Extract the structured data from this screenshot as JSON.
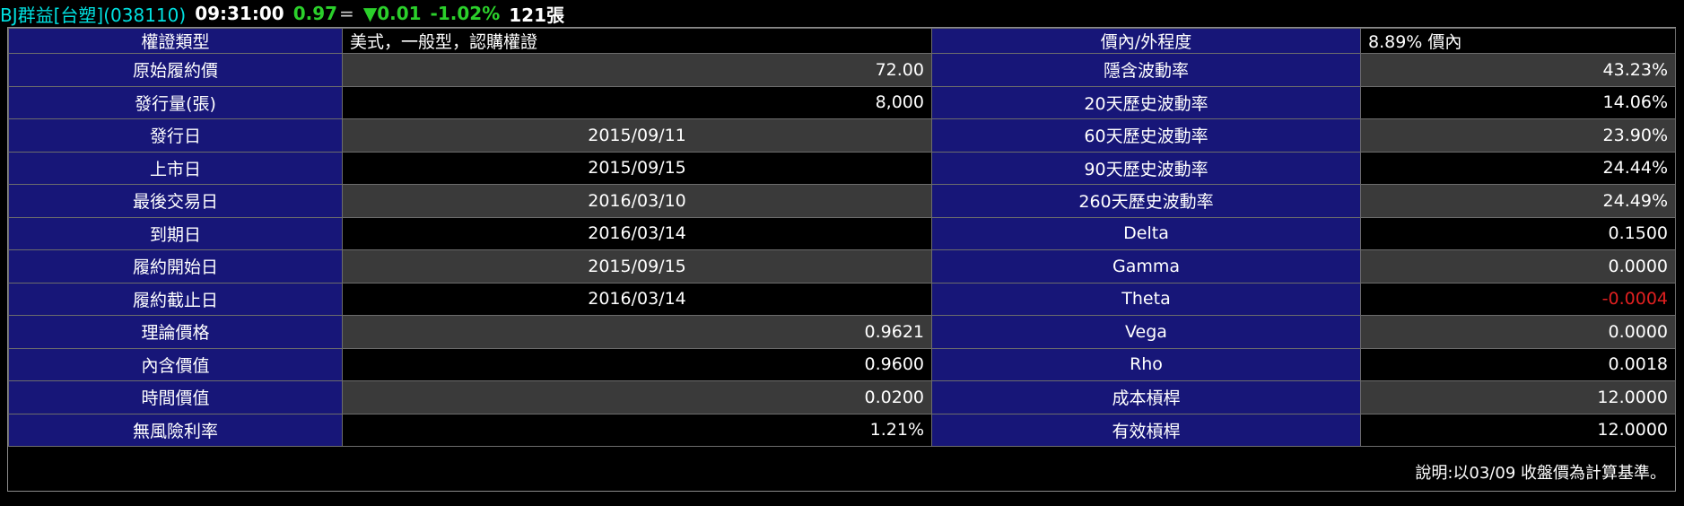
{
  "ticker": {
    "name": "BJ群益[台塑](038110)",
    "time": "09:31:00",
    "price": "0.97",
    "flat_mark": "=",
    "change": "▼0.01",
    "change_pct": "-1.02%",
    "volume": "121張"
  },
  "colors": {
    "label_bg": "#171678",
    "label_text": "#a9bfff",
    "row_gray": "#3a3a3a",
    "row_black": "#000000",
    "up_green": "#2bd02b",
    "negative_red": "#e02020",
    "ticker_name": "#00e0e0"
  },
  "rows": [
    {
      "label1": "權證類型",
      "value1": "美式，一般型，認購權證",
      "label2": "價內/外程度",
      "value2": "8.89% 價內"
    },
    {
      "label1": "原始履約價",
      "value1": "72.00",
      "label2": "隱含波動率",
      "value2": "43.23%"
    },
    {
      "label1": "發行量(張)",
      "value1": "8,000",
      "label2": "20天歷史波動率",
      "value2": "14.06%"
    },
    {
      "label1": "發行日",
      "value1": "2015/09/11",
      "label2": "60天歷史波動率",
      "value2": "23.90%"
    },
    {
      "label1": "上市日",
      "value1": "2015/09/15",
      "label2": "90天歷史波動率",
      "value2": "24.44%"
    },
    {
      "label1": "最後交易日",
      "value1": "2016/03/10",
      "label2": "260天歷史波動率",
      "value2": "24.49%"
    },
    {
      "label1": "到期日",
      "value1": "2016/03/14",
      "label2": "Delta",
      "value2": "0.1500"
    },
    {
      "label1": "履約開始日",
      "value1": "2015/09/15",
      "label2": "Gamma",
      "value2": "0.0000"
    },
    {
      "label1": "履約截止日",
      "value1": "2016/03/14",
      "label2": "Theta",
      "value2": "-0.0004"
    },
    {
      "label1": "理論價格",
      "value1": "0.9621",
      "label2": "Vega",
      "value2": "0.0000"
    },
    {
      "label1": "內含價值",
      "value1": "0.9600",
      "label2": "Rho",
      "value2": "0.0018"
    },
    {
      "label1": "時間價值",
      "value1": "0.0200",
      "label2": "成本槓桿",
      "value2": "12.0000"
    },
    {
      "label1": "無風險利率",
      "value1": "1.21%",
      "label2": "有效槓桿",
      "value2": "12.0000"
    }
  ],
  "note": "說明:以03/09 收盤價為計算基準。"
}
